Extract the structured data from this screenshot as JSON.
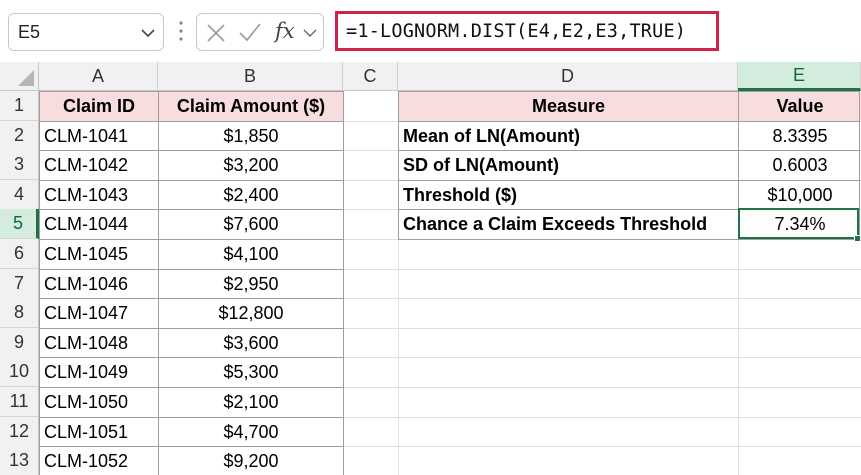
{
  "formula_bar": {
    "name_box": "E5",
    "fx_label": "fx",
    "formula": "=1-LOGNORM.DIST(E4,E2,E3,TRUE)"
  },
  "columns": [
    "A",
    "B",
    "C",
    "D",
    "E"
  ],
  "active_column": "E",
  "active_row": 5,
  "rows": [
    "1",
    "2",
    "3",
    "4",
    "5",
    "6",
    "7",
    "8",
    "9",
    "10",
    "11",
    "12",
    "13"
  ],
  "claims_table": {
    "headers": [
      "Claim ID",
      "Claim Amount ($)"
    ],
    "rows": [
      [
        "CLM-1041",
        "$1,850"
      ],
      [
        "CLM-1042",
        "$3,200"
      ],
      [
        "CLM-1043",
        "$2,400"
      ],
      [
        "CLM-1044",
        "$7,600"
      ],
      [
        "CLM-1045",
        "$4,100"
      ],
      [
        "CLM-1046",
        "$2,950"
      ],
      [
        "CLM-1047",
        "$12,800"
      ],
      [
        "CLM-1048",
        "$3,600"
      ],
      [
        "CLM-1049",
        "$5,300"
      ],
      [
        "CLM-1050",
        "$2,100"
      ],
      [
        "CLM-1051",
        "$4,700"
      ],
      [
        "CLM-1052",
        "$9,200"
      ]
    ]
  },
  "measures_table": {
    "headers": [
      "Measure",
      "Value"
    ],
    "rows": [
      [
        "Mean of LN(Amount)",
        "8.3395"
      ],
      [
        "SD of LN(Amount)",
        "0.6003"
      ],
      [
        "Threshold ($)",
        "$10,000"
      ],
      [
        "Chance a Claim Exceeds Threshold",
        "7.34%"
      ]
    ]
  },
  "colors": {
    "accent_green": "#217346",
    "header_fill": "#f7dddd",
    "formula_highlight": "#d0214d"
  }
}
